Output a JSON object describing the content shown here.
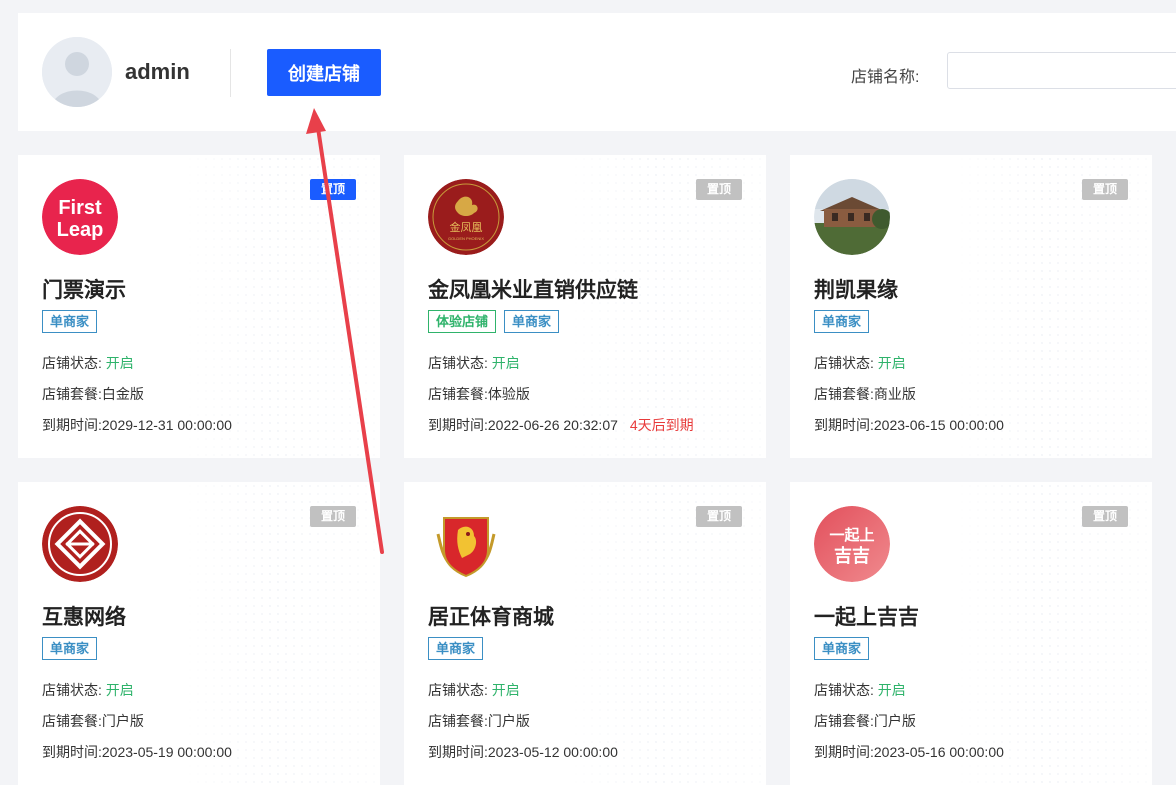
{
  "header": {
    "username": "admin",
    "create_label": "创建店铺",
    "search_label": "店铺名称:",
    "search_value": ""
  },
  "labels": {
    "status": "店铺状态:",
    "package": "店铺套餐:",
    "expire": "到期时间:",
    "pin": "置顶"
  },
  "stores": [
    {
      "name": "门票演示",
      "tags": [
        "单商家"
      ],
      "status": "开启",
      "package": "白金版",
      "expire": "2029-12-31 00:00:00",
      "warning": "",
      "pinned": true,
      "logo": "first-leap-logo",
      "logo_text1": "First",
      "logo_text2": "Leap"
    },
    {
      "name": "金凤凰米业直销供应链",
      "tags": [
        "体验店铺",
        "单商家"
      ],
      "status": "开启",
      "package": "体验版",
      "expire": "2022-06-26 20:32:07",
      "warning": "4天后到期",
      "pinned": false,
      "logo": "golden-phoenix-logo",
      "logo_text1": "金凤凰",
      "logo_text2": "GOLDEN PHOENIX"
    },
    {
      "name": "荆凯果缘",
      "tags": [
        "单商家"
      ],
      "status": "开启",
      "package": "商业版",
      "expire": "2023-06-15 00:00:00",
      "warning": "",
      "pinned": false,
      "logo": "house-photo-logo",
      "logo_text1": "",
      "logo_text2": ""
    },
    {
      "name": "互惠网络",
      "tags": [
        "单商家"
      ],
      "status": "开启",
      "package": "门户版",
      "expire": "2023-05-19 00:00:00",
      "warning": "",
      "pinned": false,
      "logo": "huhui-logo",
      "logo_text1": "",
      "logo_text2": ""
    },
    {
      "name": "居正体育商城",
      "tags": [
        "单商家"
      ],
      "status": "开启",
      "package": "门户版",
      "expire": "2023-05-12 00:00:00",
      "warning": "",
      "pinned": false,
      "logo": "lion-shield-logo",
      "logo_text1": "",
      "logo_text2": ""
    },
    {
      "name": "一起上吉吉",
      "tags": [
        "单商家"
      ],
      "status": "开启",
      "package": "门户版",
      "expire": "2023-05-16 00:00:00",
      "warning": "",
      "pinned": false,
      "logo": "yiqishang-logo",
      "logo_text1": "一起上",
      "logo_text2": "吉吉"
    }
  ],
  "colors": {
    "primary": "#1a5cff",
    "arrow": "#e8404a",
    "green": "#2fb36b",
    "tag_blue": "#3b8fc4",
    "warning": "#e83b3b",
    "pin_inactive": "#c1c1c1"
  }
}
